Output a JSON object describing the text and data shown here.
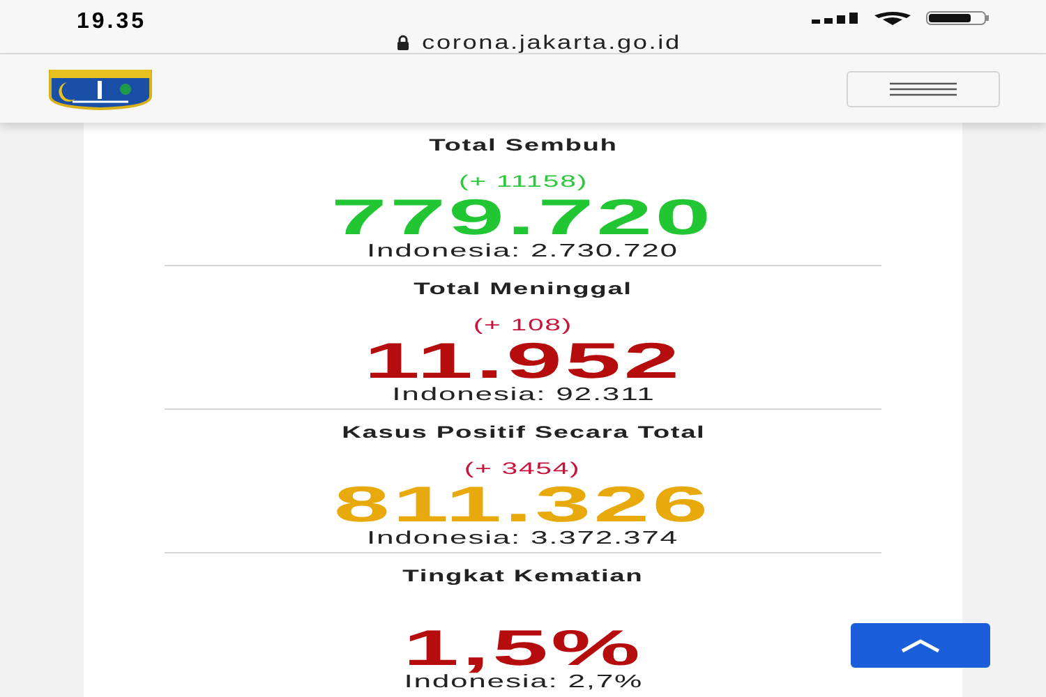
{
  "status_bar": {
    "time": "19.35",
    "url": "corona.jakarta.go.id"
  },
  "stats": [
    {
      "title": "Total Sembuh",
      "delta": {
        "text": "(+ 11158)",
        "color": "#2ec73d"
      },
      "value": "779.720",
      "color": "#22c532",
      "national": "Indonesia: 2.730.720"
    },
    {
      "title": "Total Meninggal",
      "delta": {
        "text": "(+ 108)",
        "color": "#c8143c"
      },
      "value": "11.952",
      "color": "#b50d0d",
      "national": "Indonesia: 92.311"
    },
    {
      "title": "Kasus Positif Secara Total",
      "delta": {
        "text": "(+ 3454)",
        "color": "#c8143c"
      },
      "value": "811.326",
      "color": "#e8a90c",
      "national": "Indonesia: 3.372.374"
    },
    {
      "title": "Tingkat Kematian",
      "value": "1,5%",
      "color": "#b50d0d",
      "national": "Indonesia: 2,7%"
    }
  ]
}
